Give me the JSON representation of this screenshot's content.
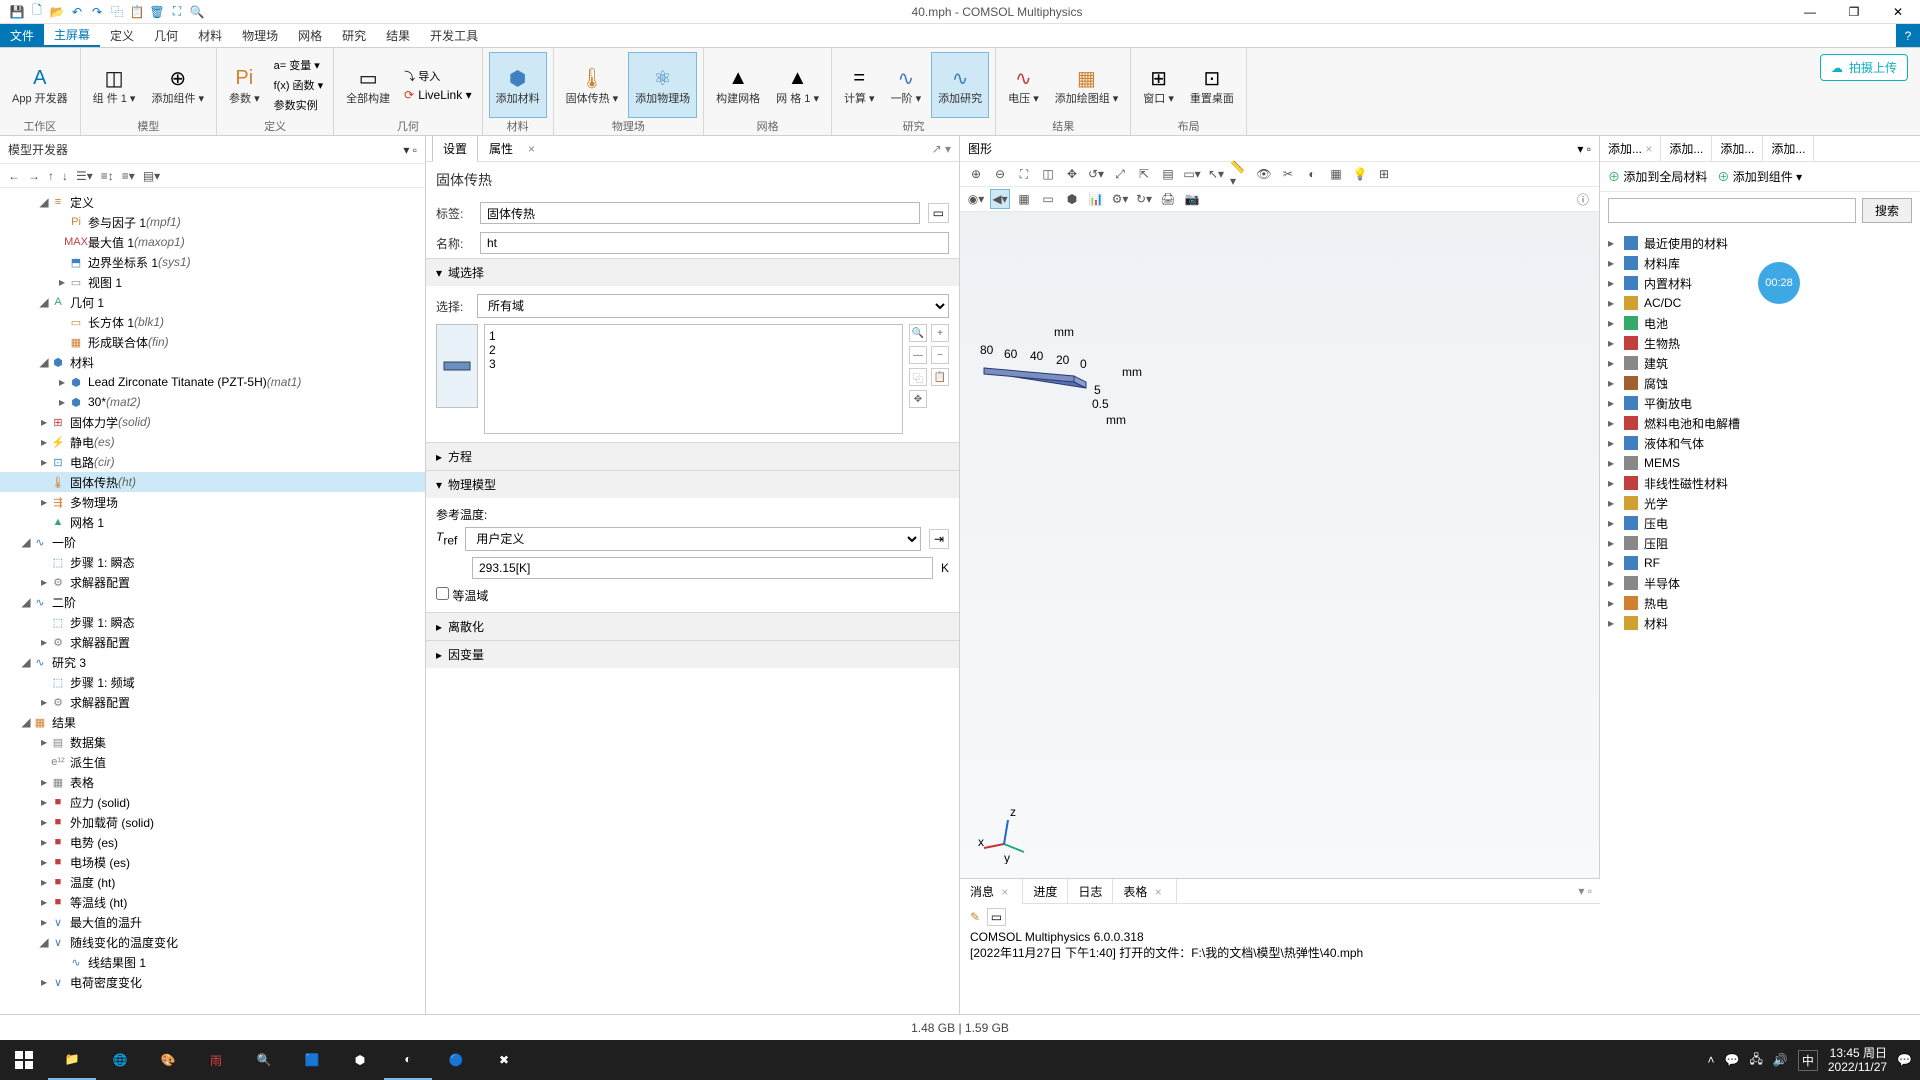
{
  "window": {
    "title": "40.mph - COMSOL Multiphysics"
  },
  "menu": {
    "file": "文件",
    "items": [
      "主屏幕",
      "定义",
      "几何",
      "材料",
      "物理场",
      "网格",
      "研究",
      "结果",
      "开发工具"
    ],
    "active": 0
  },
  "ribbon": {
    "upload": "拍摄上传",
    "groups": {
      "workspace": {
        "label": "工作区",
        "app": "App\n开发器"
      },
      "model": {
        "label": "模型",
        "comp": "组\n件 1 ▾",
        "add": "添加组件\n▾"
      },
      "def": {
        "label": "定义",
        "param": "参数\n▾",
        "var": "a= 变量 ▾",
        "func": "f(x) 函数 ▾",
        "pi": "Pi",
        "case": "参数实例"
      },
      "geom": {
        "label": "几何",
        "build": "全部构建",
        "import": "⤵ 导入",
        "livelink": "LiveLink ▾"
      },
      "material": {
        "label": "材料",
        "add": "添加材料"
      },
      "physics": {
        "label": "物理场",
        "ht": "固体传热\n▾",
        "add": "添加物理场"
      },
      "mesh": {
        "label": "网格",
        "build": "构建网格",
        "mesh1": "网\n格 1 ▾"
      },
      "study": {
        "label": "研究",
        "compute": "计算\n▾",
        "step": "一阶\n▾",
        "add": "添加研究"
      },
      "results": {
        "label": "结果",
        "voltage": "电压\n▾",
        "addplot": "添加绘图组\n▾"
      },
      "layout": {
        "label": "布局",
        "windows": "窗口\n▾",
        "reset": "重置桌面"
      }
    }
  },
  "tree": {
    "title": "模型开发器",
    "nodes": [
      {
        "d": 1,
        "c": "◢",
        "ic": "≡",
        "t": "定义",
        "col": "#d08030"
      },
      {
        "d": 2,
        "c": "",
        "ic": "Pi",
        "t": "参与因子 1 ",
        "it": "(mpf1)",
        "col": "#d08030"
      },
      {
        "d": 2,
        "c": "",
        "ic": "MAX",
        "t": "最大值 1 ",
        "it": "(maxop1)",
        "col": "#c04040"
      },
      {
        "d": 2,
        "c": "",
        "ic": "⬒",
        "t": "边界坐标系 1 ",
        "it": "(sys1)",
        "col": "#4080c0"
      },
      {
        "d": 2,
        "c": "▸",
        "ic": "▭",
        "t": "视图 1",
        "col": "#888"
      },
      {
        "d": 1,
        "c": "◢",
        "ic": "A",
        "t": "几何 1",
        "col": "#3a6"
      },
      {
        "d": 2,
        "c": "",
        "ic": "▭",
        "t": "长方体 1 ",
        "it": "(blk1)",
        "col": "#d08030"
      },
      {
        "d": 2,
        "c": "",
        "ic": "▦",
        "t": "形成联合体 ",
        "it": "(fin)",
        "col": "#d08030"
      },
      {
        "d": 1,
        "c": "◢",
        "ic": "⬢",
        "t": "材料",
        "col": "#4080c0"
      },
      {
        "d": 2,
        "c": "▸",
        "ic": "⬢",
        "t": "Lead Zirconate Titanate (PZT-5H) ",
        "it": "(mat1)",
        "col": "#4080c0"
      },
      {
        "d": 2,
        "c": "▸",
        "ic": "⬢",
        "t": "30* ",
        "it": "(mat2)",
        "col": "#4080c0"
      },
      {
        "d": 1,
        "c": "▸",
        "ic": "⊞",
        "t": "固体力学 ",
        "it": "(solid)",
        "col": "#c04040"
      },
      {
        "d": 1,
        "c": "▸",
        "ic": "⚡",
        "t": "静电 ",
        "it": "(es)",
        "col": "#d0a030"
      },
      {
        "d": 1,
        "c": "▸",
        "ic": "⊡",
        "t": "电路 ",
        "it": "(cir)",
        "col": "#4080c0"
      },
      {
        "d": 1,
        "c": "",
        "ic": "🌡",
        "t": "固体传热 ",
        "it": "(ht)",
        "col": "#d08030",
        "sel": true
      },
      {
        "d": 1,
        "c": "▸",
        "ic": "⇶",
        "t": "多物理场",
        "col": "#d08030"
      },
      {
        "d": 1,
        "c": "",
        "ic": "▲",
        "t": "网格 1",
        "col": "#3a6"
      },
      {
        "d": 0,
        "c": "◢",
        "ic": "∿",
        "t": "一阶",
        "col": "#4080c0"
      },
      {
        "d": 1,
        "c": "",
        "ic": "⬚",
        "t": "步骤 1: 瞬态",
        "col": "#4080c0"
      },
      {
        "d": 1,
        "c": "▸",
        "ic": "⚙",
        "t": "求解器配置",
        "col": "#888"
      },
      {
        "d": 0,
        "c": "◢",
        "ic": "∿",
        "t": "二阶",
        "col": "#4080c0"
      },
      {
        "d": 1,
        "c": "",
        "ic": "⬚",
        "t": "步骤 1: 瞬态",
        "col": "#4080c0"
      },
      {
        "d": 1,
        "c": "▸",
        "ic": "⚙",
        "t": "求解器配置",
        "col": "#888"
      },
      {
        "d": 0,
        "c": "◢",
        "ic": "∿",
        "t": "研究 3",
        "col": "#4080c0"
      },
      {
        "d": 1,
        "c": "",
        "ic": "⬚",
        "t": "步骤 1: 频域",
        "col": "#4080c0"
      },
      {
        "d": 1,
        "c": "▸",
        "ic": "⚙",
        "t": "求解器配置",
        "col": "#888"
      },
      {
        "d": 0,
        "c": "◢",
        "ic": "▦",
        "t": "结果",
        "col": "#d08030"
      },
      {
        "d": 1,
        "c": "▸",
        "ic": "▤",
        "t": "数据集",
        "col": "#888"
      },
      {
        "d": 1,
        "c": "",
        "ic": "e¹²",
        "t": "派生值",
        "col": "#888"
      },
      {
        "d": 1,
        "c": "▸",
        "ic": "▦",
        "t": "表格",
        "col": "#888"
      },
      {
        "d": 1,
        "c": "▸",
        "ic": "■",
        "t": "应力 (solid)",
        "col": "#c04040"
      },
      {
        "d": 1,
        "c": "▸",
        "ic": "■",
        "t": "外加载荷 (solid)",
        "col": "#c04040"
      },
      {
        "d": 1,
        "c": "▸",
        "ic": "■",
        "t": "电势 (es)",
        "col": "#c04040"
      },
      {
        "d": 1,
        "c": "▸",
        "ic": "■",
        "t": "电场模 (es)",
        "col": "#c04040"
      },
      {
        "d": 1,
        "c": "▸",
        "ic": "■",
        "t": "温度 (ht)",
        "col": "#c04040"
      },
      {
        "d": 1,
        "c": "▸",
        "ic": "■",
        "t": "等温线 (ht)",
        "col": "#c04040"
      },
      {
        "d": 1,
        "c": "▸",
        "ic": "∨",
        "t": "最大值的温升",
        "col": "#4080c0"
      },
      {
        "d": 1,
        "c": "◢",
        "ic": "∨",
        "t": "随线变化的温度变化",
        "col": "#4080c0"
      },
      {
        "d": 2,
        "c": "",
        "ic": "∿",
        "t": "线结果图 1",
        "col": "#4080c0"
      },
      {
        "d": 1,
        "c": "▸",
        "ic": "∨",
        "t": "电荷密度变化",
        "col": "#4080c0"
      }
    ]
  },
  "settings": {
    "tabs": {
      "settings": "设置",
      "props": "属性"
    },
    "heading": "固体传热",
    "label_l": "标签:",
    "label_v": "固体传热",
    "name_l": "名称:",
    "name_v": "ht",
    "sec_domain": "域选择",
    "select_l": "选择:",
    "select_v": "所有域",
    "domains": [
      "1",
      "2",
      "3"
    ],
    "sec_eq": "方程",
    "sec_model": "物理模型",
    "reftemp_l": "参考温度:",
    "tref": "T",
    "tref_sub": "ref",
    "tref_sel": "用户定义",
    "tref_val": "293.15[K]",
    "unit": "K",
    "isothermal": "等温域",
    "sec_disc": "离散化",
    "sec_depvar": "因变量"
  },
  "graphics": {
    "title": "图形",
    "labels": {
      "mm1": "mm",
      "mm2": "mm",
      "mm3": "mm",
      "v80": "80",
      "v60": "60",
      "v40": "40",
      "v20": "20",
      "v0": "0",
      "v5": "5",
      "v05": "0.5"
    }
  },
  "messages": {
    "tabs": [
      "消息",
      "进度",
      "日志",
      "表格"
    ],
    "line1": "COMSOL Multiphysics 6.0.0.318",
    "line2": "[2022年11月27日 下午1:40] 打开的文件：F:\\我的文档\\模型\\热弹性\\40.mph"
  },
  "mats": {
    "tabs": [
      "添加...",
      "添加...",
      "添加...",
      "添加..."
    ],
    "add_global": "添加到全局材料",
    "add_comp": "添加到组件 ▾",
    "search": "搜索",
    "items": [
      {
        "t": "最近使用的材料",
        "c": "#4080c0"
      },
      {
        "t": "材料库",
        "c": "#4080c0"
      },
      {
        "t": "内置材料",
        "c": "#4080c0"
      },
      {
        "t": "AC/DC",
        "c": "#d0a030"
      },
      {
        "t": "电池",
        "c": "#3a6"
      },
      {
        "t": "生物热",
        "c": "#c04040"
      },
      {
        "t": "建筑",
        "c": "#888"
      },
      {
        "t": "腐蚀",
        "c": "#a06030"
      },
      {
        "t": "平衡放电",
        "c": "#4080c0"
      },
      {
        "t": "燃料电池和电解槽",
        "c": "#c04040"
      },
      {
        "t": "液体和气体",
        "c": "#4080c0"
      },
      {
        "t": "MEMS",
        "c": "#888"
      },
      {
        "t": "非线性磁性材料",
        "c": "#c04040"
      },
      {
        "t": "光学",
        "c": "#d0a030"
      },
      {
        "t": "压电",
        "c": "#4080c0"
      },
      {
        "t": "压阻",
        "c": "#888"
      },
      {
        "t": "RF",
        "c": "#4080c0"
      },
      {
        "t": "半导体",
        "c": "#888"
      },
      {
        "t": "热电",
        "c": "#d08030"
      },
      {
        "t": "材料",
        "c": "#d0a030"
      }
    ]
  },
  "timer": "00:28",
  "status": "1.48 GB | 1.59 GB",
  "taskbar": {
    "clock": {
      "time": "13:45",
      "day": "周日",
      "date": "2022/11/27"
    },
    "ime": "中"
  }
}
